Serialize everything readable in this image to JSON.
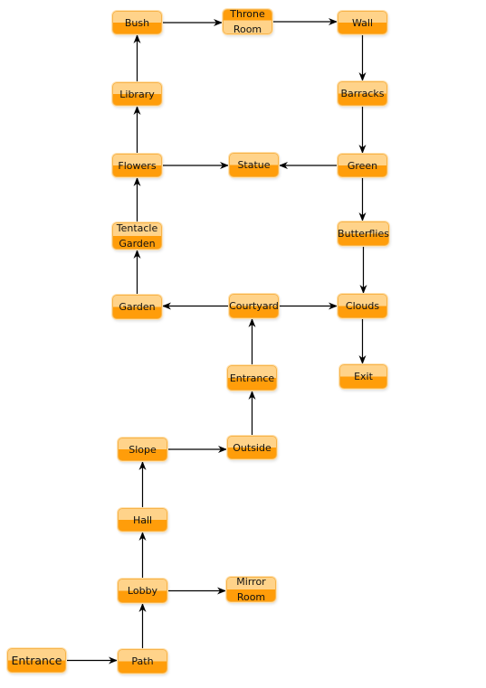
{
  "diagram": {
    "node_colors": {
      "light": "#ffd38a",
      "dark": "#ff9d0a",
      "border": "#f7b34a"
    },
    "edge_color": "#000000",
    "nodes": [
      {
        "id": "bush",
        "label": "Bush"
      },
      {
        "id": "throne",
        "label": "Throne Room"
      },
      {
        "id": "wall",
        "label": "Wall"
      },
      {
        "id": "library",
        "label": "Library"
      },
      {
        "id": "barracks",
        "label": "Barracks"
      },
      {
        "id": "flowers",
        "label": "Flowers"
      },
      {
        "id": "statue",
        "label": "Statue"
      },
      {
        "id": "green",
        "label": "Green"
      },
      {
        "id": "tentacle",
        "label": "Tentacle Garden"
      },
      {
        "id": "butterflies",
        "label": "Butterflies"
      },
      {
        "id": "garden",
        "label": "Garden"
      },
      {
        "id": "courtyard",
        "label": "Courtyard"
      },
      {
        "id": "clouds",
        "label": "Clouds"
      },
      {
        "id": "entrance_inner",
        "label": "Entrance"
      },
      {
        "id": "exit",
        "label": "Exit"
      },
      {
        "id": "slope",
        "label": "Slope"
      },
      {
        "id": "outside",
        "label": "Outside"
      },
      {
        "id": "hall",
        "label": "Hall"
      },
      {
        "id": "lobby",
        "label": "Lobby"
      },
      {
        "id": "mirror",
        "label": "Mirror Room"
      },
      {
        "id": "entrance_start",
        "label": "Entrance"
      },
      {
        "id": "path",
        "label": "Path"
      }
    ],
    "edges": [
      [
        "bush",
        "throne"
      ],
      [
        "throne",
        "wall"
      ],
      [
        "wall",
        "barracks"
      ],
      [
        "barracks",
        "green"
      ],
      [
        "green",
        "statue"
      ],
      [
        "flowers",
        "statue"
      ],
      [
        "green",
        "butterflies"
      ],
      [
        "butterflies",
        "clouds"
      ],
      [
        "clouds",
        "exit"
      ],
      [
        "courtyard",
        "clouds"
      ],
      [
        "courtyard",
        "garden"
      ],
      [
        "garden",
        "tentacle"
      ],
      [
        "tentacle",
        "flowers"
      ],
      [
        "flowers",
        "library"
      ],
      [
        "library",
        "bush"
      ],
      [
        "entrance_inner",
        "courtyard"
      ],
      [
        "outside",
        "entrance_inner"
      ],
      [
        "slope",
        "outside"
      ],
      [
        "hall",
        "slope"
      ],
      [
        "lobby",
        "hall"
      ],
      [
        "lobby",
        "mirror"
      ],
      [
        "path",
        "lobby"
      ],
      [
        "entrance_start",
        "path"
      ]
    ]
  }
}
